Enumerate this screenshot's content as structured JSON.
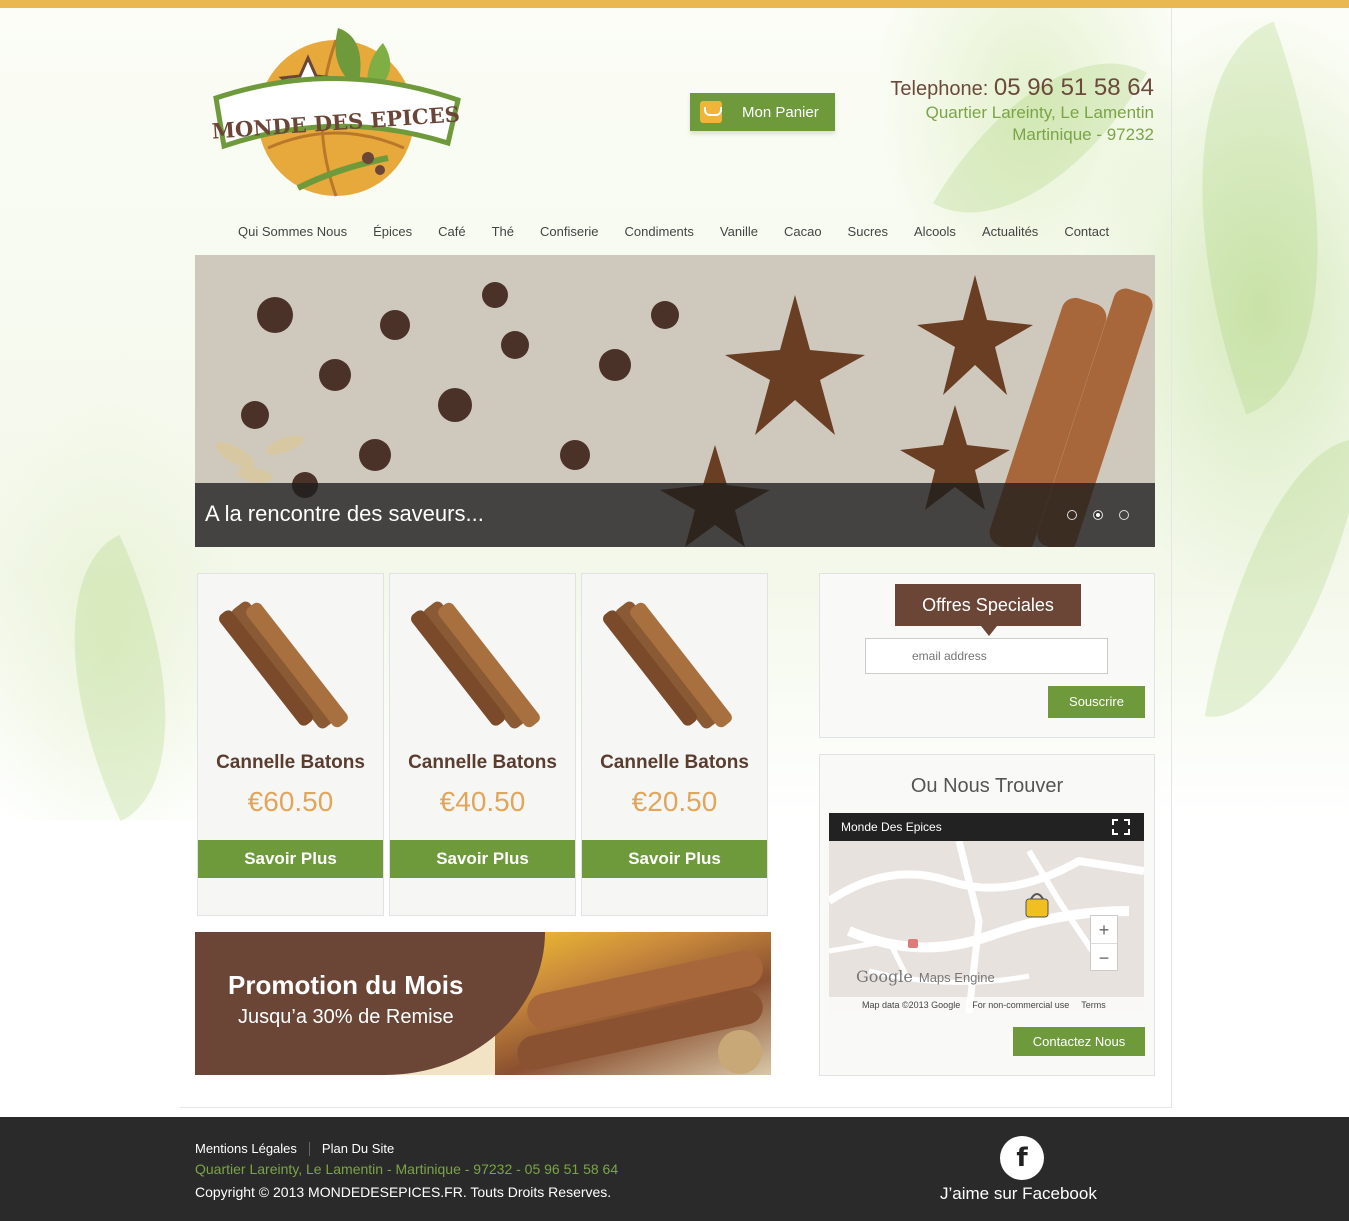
{
  "header": {
    "brand_name": "MONDE DES EPICES",
    "cart_label": "Mon Panier",
    "phone_label": "Telephone:",
    "phone_number": "05 96 51 58 64",
    "address_line1": "Quartier Lareinty, Le Lamentin",
    "address_line2": "Martinique - 97232"
  },
  "nav": {
    "items": [
      "Qui Sommes Nous",
      "Épices",
      "Café",
      "Thé",
      "Confiserie",
      "Condiments",
      "Vanille",
      "Cacao",
      "Sucres",
      "Alcools",
      "Actualités",
      "Contact"
    ]
  },
  "slider": {
    "caption": "A la rencontre des saveurs...",
    "dot_count": 3,
    "active_dot": 2
  },
  "products": [
    {
      "name": "Cannelle Batons",
      "price": "€60.50",
      "button": "Savoir Plus"
    },
    {
      "name": "Cannelle Batons",
      "price": "€40.50",
      "button": "Savoir Plus"
    },
    {
      "name": "Cannelle Batons",
      "price": "€20.50",
      "button": "Savoir Plus"
    }
  ],
  "promo": {
    "title": "Promotion du Mois",
    "subtitle": "Jusqu’a 30% de Remise"
  },
  "offers": {
    "title": "Offres Speciales",
    "email_placeholder": "email address",
    "subscribe_label": "Souscrire"
  },
  "map": {
    "title": "Ou Nous Trouver",
    "place_name": "Monde Des Epices",
    "brand": "Google",
    "brand_sub": "Maps Engine",
    "footer_data": "Map data ©2013 Google",
    "footer_use": "For non-commercial use",
    "footer_terms": "Terms",
    "contact_label": "Contactez Nous"
  },
  "footer": {
    "link_legal": "Mentions Légales",
    "link_sitemap": "Plan Du Site",
    "address": "Quartier Lareinty, Le Lamentin - Martinique - 97232 - 05 96 51 58 64",
    "copyright": "Copyright © 2013 MONDEDESEPICES.FR. Touts Droits Reserves.",
    "facebook_label": "J’aime sur Facebook"
  },
  "icons": {
    "cart": "shopping-basket-icon",
    "fullscreen": "fullscreen-icon",
    "facebook": "facebook-icon",
    "map_marker": "shopping-bag-marker-icon"
  },
  "colors": {
    "accent_green": "#6e9a3c",
    "brown": "#6b4536",
    "gold_strip": "#e9b850",
    "price": "#e2a55a"
  }
}
